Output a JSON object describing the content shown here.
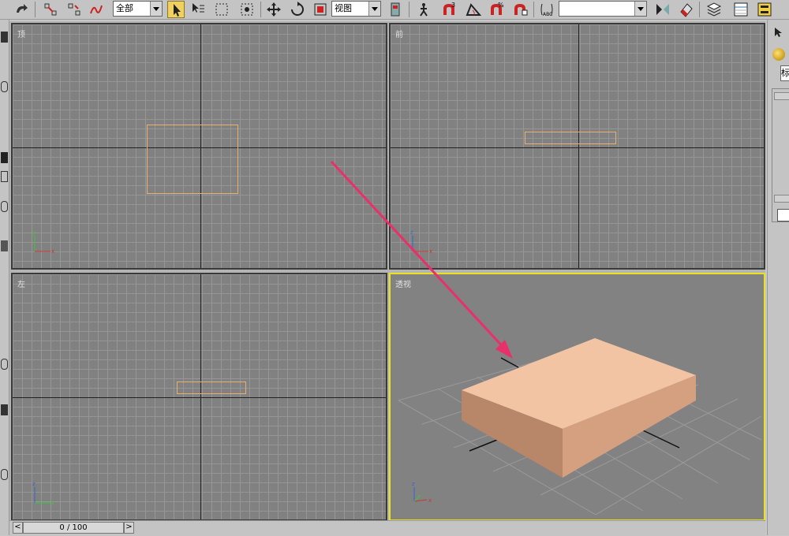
{
  "toolbar": {
    "filter_select": "全部",
    "coord_select": "视图",
    "named_selection": ""
  },
  "viewports": {
    "top": "顶",
    "front": "前",
    "left": "左",
    "perspective": "透视"
  },
  "timeline": {
    "frame_counter": "0 / 100",
    "prev": "<",
    "next": ">"
  },
  "right_panel": {
    "tab_label": "标"
  },
  "colors": {
    "viewport_bg": "#818181",
    "grid_line": "#969696",
    "active_border": "#e8e020",
    "box_face": "#f2c4a4",
    "annotation_arrow": "#e8306a"
  }
}
